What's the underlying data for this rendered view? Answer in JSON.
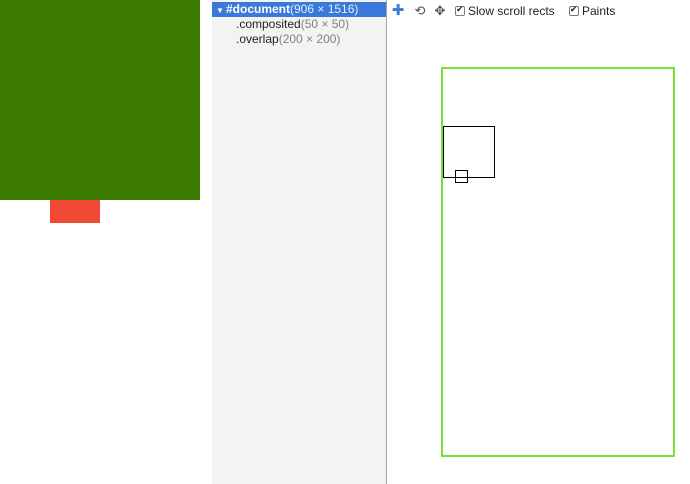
{
  "layer_tree": {
    "root": {
      "arrow": "▼",
      "name": "#document",
      "size": "(906 × 1516)"
    },
    "children": [
      {
        "name": ".composited",
        "size": "(50 × 50)"
      },
      {
        "name": ".overlap",
        "size": "(200 × 200)"
      }
    ]
  },
  "toolbar": {
    "pan_icon": "✚",
    "rotate_icon": "⟲",
    "move_icon": "✥",
    "slow_scroll_label": "Slow scroll rects",
    "slow_scroll_checked": true,
    "paints_label": "Paints",
    "paints_checked": true,
    "check_glyph": "✔"
  },
  "colors": {
    "green_layer": "#3a7a00",
    "red_layer": "#f04a35",
    "selection": "#3879d9",
    "viewport_border": "#7ce033"
  }
}
